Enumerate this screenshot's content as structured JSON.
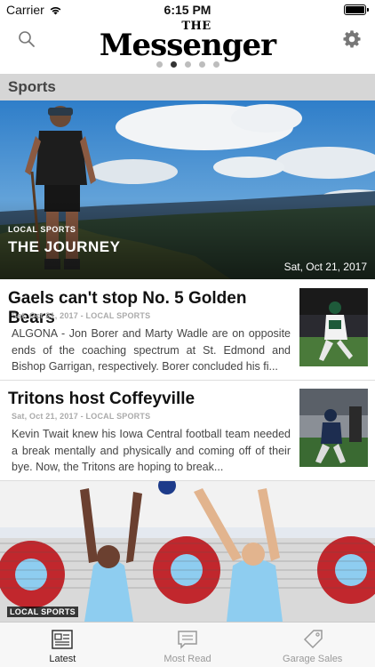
{
  "status": {
    "carrier": "Carrier",
    "time": "6:15 PM"
  },
  "header": {
    "logo_the": "THE",
    "logo_main": "Messenger"
  },
  "section": {
    "title": "Sports"
  },
  "hero": {
    "category": "LOCAL SPORTS",
    "title": "THE JOURNEY",
    "date": "Sat, Oct 21, 2017"
  },
  "articles": [
    {
      "title": "Gaels can't stop No. 5 Golden Bears",
      "meta": "Sat, Oct 21, 2017 - LOCAL SPORTS",
      "body": "ALGONA - Jon Borer and Marty Wadle are on opposite ends of the coaching spectrum at St. Edmond and Bishop Garrigan, respectively. Borer concluded his fi..."
    },
    {
      "title": "Tritons host Coffeyville",
      "meta": "Sat, Oct 21, 2017 - LOCAL SPORTS",
      "body": "Kevin Twait knew his Iowa Central football team needed a break mentally and physically and coming off of their bye. Now, the Tritons are hoping to break..."
    }
  ],
  "bottom_story": {
    "category": "LOCAL SPORTS"
  },
  "tabs": [
    {
      "label": "Latest",
      "icon": "newspaper-icon",
      "active": true
    },
    {
      "label": "Most Read",
      "icon": "message-icon",
      "active": false
    },
    {
      "label": "Garage Sales",
      "icon": "tag-icon",
      "active": false
    }
  ]
}
